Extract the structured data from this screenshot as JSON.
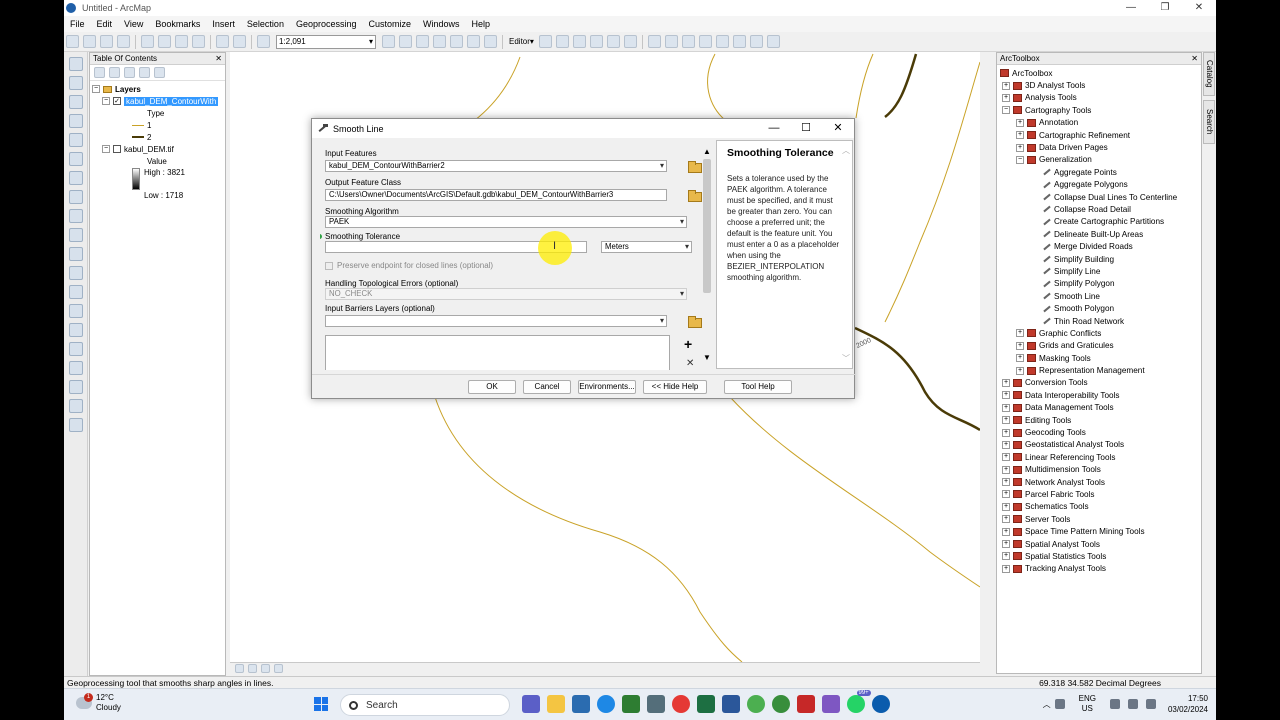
{
  "window": {
    "title": "Untitled - ArcMap"
  },
  "menubar": {
    "items": [
      "File",
      "Edit",
      "View",
      "Bookmarks",
      "Insert",
      "Selection",
      "Geoprocessing",
      "Customize",
      "Windows",
      "Help"
    ]
  },
  "toolbar": {
    "scale": "1:2,091",
    "editor_label": "Editor▾"
  },
  "toc": {
    "title": "Table Of Contents",
    "layers_label": "Layers",
    "layer1": {
      "name": "kabul_DEM_ContourWith",
      "field_label": "Type",
      "class1": "1",
      "class2": "2"
    },
    "layer2": {
      "name": "kabul_DEM.tif",
      "value_label": "Value",
      "high_label": "High : 3821",
      "low_label": "Low : 1718"
    }
  },
  "map": {
    "contour_label": "2000"
  },
  "dialog": {
    "title": "Smooth Line",
    "input_features_label": "Input Features",
    "input_features_value": "kabul_DEM_ContourWithBarrier2",
    "output_label": "Output Feature Class",
    "output_value": "C:\\Users\\Owner\\Documents\\ArcGIS\\Default.gdb\\kabul_DEM_ContourWithBarrier3",
    "algorithm_label": "Smoothing Algorithm",
    "algorithm_value": "PAEK",
    "tolerance_label": "Smoothing Tolerance",
    "tolerance_value": "",
    "tolerance_unit": "Meters",
    "preserve_label": "Preserve endpoint for closed lines (optional)",
    "topo_label": "Handling Topological Errors (optional)",
    "topo_value": "NO_CHECK",
    "barriers_label": "Input Barriers Layers (optional)",
    "barriers_value": "",
    "help_title": "Smoothing Tolerance",
    "help_text": "Sets a tolerance used by the PAEK algorithm. A tolerance must be specified, and it must be greater than zero. You can choose a preferred unit; the default is the feature unit. You must enter a 0 as a placeholder when using the BEZIER_INTERPOLATION smoothing algorithm.",
    "buttons": {
      "ok": "OK",
      "cancel": "Cancel",
      "environments": "Environments...",
      "hide_help": "<< Hide Help",
      "tool_help": "Tool Help"
    }
  },
  "toolbox": {
    "title": "ArcToolbox",
    "root": "ArcToolbox",
    "items": [
      {
        "label": "3D Analyst Tools",
        "level": 1,
        "kind": "box",
        "exp": "+"
      },
      {
        "label": "Analysis Tools",
        "level": 1,
        "kind": "box",
        "exp": "+"
      },
      {
        "label": "Cartography Tools",
        "level": 1,
        "kind": "box",
        "exp": "−"
      },
      {
        "label": "Annotation",
        "level": 2,
        "kind": "box",
        "exp": "+"
      },
      {
        "label": "Cartographic Refinement",
        "level": 2,
        "kind": "box",
        "exp": "+"
      },
      {
        "label": "Data Driven Pages",
        "level": 2,
        "kind": "box",
        "exp": "+"
      },
      {
        "label": "Generalization",
        "level": 2,
        "kind": "box",
        "exp": "−"
      },
      {
        "label": "Aggregate Points",
        "level": 3,
        "kind": "tool"
      },
      {
        "label": "Aggregate Polygons",
        "level": 3,
        "kind": "tool"
      },
      {
        "label": "Collapse Dual Lines To Centerline",
        "level": 3,
        "kind": "tool"
      },
      {
        "label": "Collapse Road Detail",
        "level": 3,
        "kind": "tool"
      },
      {
        "label": "Create Cartographic Partitions",
        "level": 3,
        "kind": "tool"
      },
      {
        "label": "Delineate Built-Up Areas",
        "level": 3,
        "kind": "tool"
      },
      {
        "label": "Merge Divided Roads",
        "level": 3,
        "kind": "tool"
      },
      {
        "label": "Simplify Building",
        "level": 3,
        "kind": "tool"
      },
      {
        "label": "Simplify Line",
        "level": 3,
        "kind": "tool"
      },
      {
        "label": "Simplify Polygon",
        "level": 3,
        "kind": "tool"
      },
      {
        "label": "Smooth Line",
        "level": 3,
        "kind": "tool"
      },
      {
        "label": "Smooth Polygon",
        "level": 3,
        "kind": "tool"
      },
      {
        "label": "Thin Road Network",
        "level": 3,
        "kind": "tool"
      },
      {
        "label": "Graphic Conflicts",
        "level": 2,
        "kind": "box",
        "exp": "+"
      },
      {
        "label": "Grids and Graticules",
        "level": 2,
        "kind": "box",
        "exp": "+"
      },
      {
        "label": "Masking Tools",
        "level": 2,
        "kind": "box",
        "exp": "+"
      },
      {
        "label": "Representation Management",
        "level": 2,
        "kind": "box",
        "exp": "+"
      },
      {
        "label": "Conversion Tools",
        "level": 1,
        "kind": "box",
        "exp": "+"
      },
      {
        "label": "Data Interoperability Tools",
        "level": 1,
        "kind": "box",
        "exp": "+"
      },
      {
        "label": "Data Management Tools",
        "level": 1,
        "kind": "box",
        "exp": "+"
      },
      {
        "label": "Editing Tools",
        "level": 1,
        "kind": "box",
        "exp": "+"
      },
      {
        "label": "Geocoding Tools",
        "level": 1,
        "kind": "box",
        "exp": "+"
      },
      {
        "label": "Geostatistical Analyst Tools",
        "level": 1,
        "kind": "box",
        "exp": "+"
      },
      {
        "label": "Linear Referencing Tools",
        "level": 1,
        "kind": "box",
        "exp": "+"
      },
      {
        "label": "Multidimension Tools",
        "level": 1,
        "kind": "box",
        "exp": "+"
      },
      {
        "label": "Network Analyst Tools",
        "level": 1,
        "kind": "box",
        "exp": "+"
      },
      {
        "label": "Parcel Fabric Tools",
        "level": 1,
        "kind": "box",
        "exp": "+"
      },
      {
        "label": "Schematics Tools",
        "level": 1,
        "kind": "box",
        "exp": "+"
      },
      {
        "label": "Server Tools",
        "level": 1,
        "kind": "box",
        "exp": "+"
      },
      {
        "label": "Space Time Pattern Mining Tools",
        "level": 1,
        "kind": "box",
        "exp": "+"
      },
      {
        "label": "Spatial Analyst Tools",
        "level": 1,
        "kind": "box",
        "exp": "+"
      },
      {
        "label": "Spatial Statistics Tools",
        "level": 1,
        "kind": "box",
        "exp": "+"
      },
      {
        "label": "Tracking Analyst Tools",
        "level": 1,
        "kind": "box",
        "exp": "+"
      }
    ]
  },
  "side_tabs": [
    "Catalog",
    "Search"
  ],
  "statusbar": {
    "message": "Geoprocessing tool that smooths sharp angles in lines.",
    "coords": "69.318  34.582 Decimal Degrees"
  },
  "taskbar": {
    "notif_count": "1",
    "temperature": "12°C",
    "condition": "Cloudy",
    "search_placeholder": "Search",
    "badge": "99+",
    "lang_line1": "ENG",
    "lang_line2": "US",
    "time": "17:50",
    "date": "03/02/2024"
  },
  "colors": {
    "accent": "#3399ff",
    "contour_thin": "#c9a227",
    "contour_thick": "#4a3b07"
  }
}
